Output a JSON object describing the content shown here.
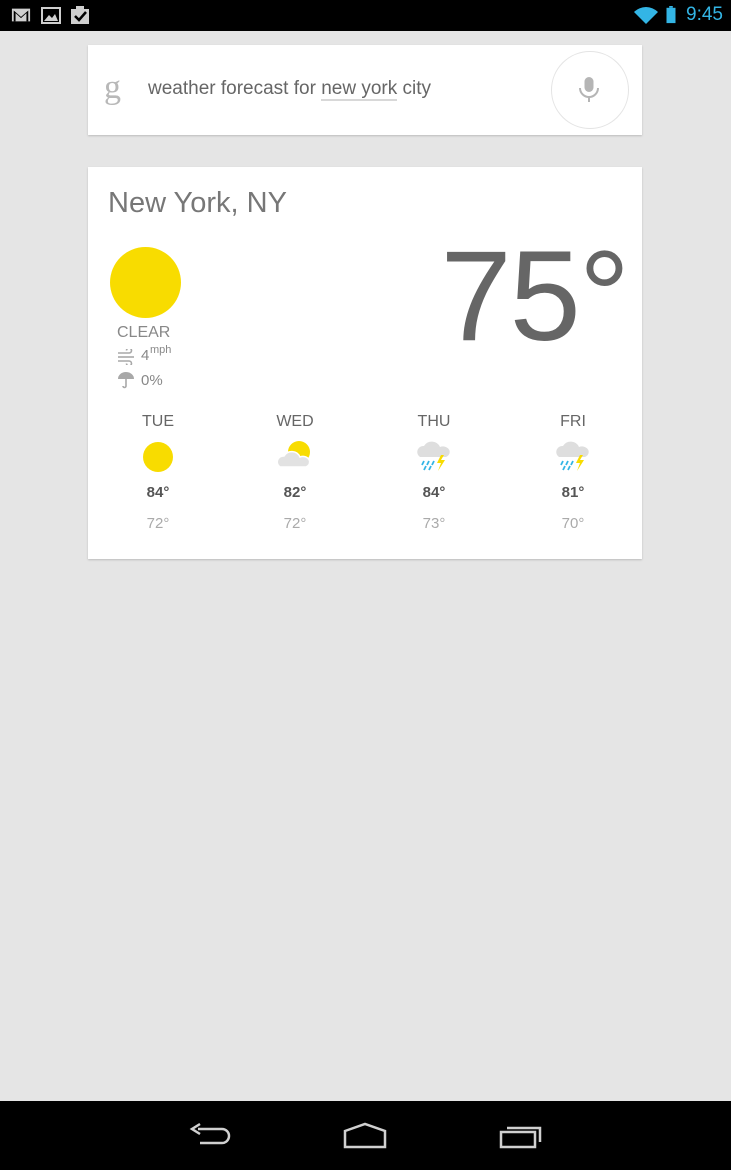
{
  "status_bar": {
    "time": "9:45",
    "left_icons": [
      "gmail-icon",
      "gallery-icon",
      "tasks-icon"
    ],
    "right_icons": [
      "wifi-icon",
      "battery-icon"
    ],
    "accent_color": "#33b5e5"
  },
  "search": {
    "logo": "g",
    "query_prefix": "weather forecast for ",
    "query_highlight": "new york",
    "query_suffix": " city"
  },
  "weather": {
    "location": "New York, NY",
    "condition": "CLEAR",
    "wind_speed": "4",
    "wind_unit": "mph",
    "precipitation": "0%",
    "temperature": "75°",
    "sun_color": "#f8dc00",
    "forecast": [
      {
        "day": "TUE",
        "icon": "sun-icon",
        "high": "84°",
        "low": "72°"
      },
      {
        "day": "WED",
        "icon": "partly-cloudy-icon",
        "high": "82°",
        "low": "72°"
      },
      {
        "day": "THU",
        "icon": "thunderstorm-icon",
        "high": "84°",
        "low": "73°"
      },
      {
        "day": "FRI",
        "icon": "thunderstorm-icon",
        "high": "81°",
        "low": "70°"
      }
    ]
  },
  "nav": [
    "back-icon",
    "home-icon",
    "recent-apps-icon"
  ]
}
